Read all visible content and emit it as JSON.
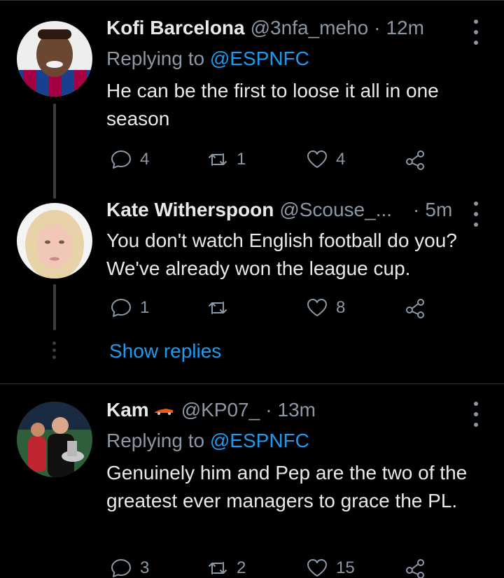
{
  "tweets": [
    {
      "name": "Kofi Barcelona",
      "handle": "@3nfa_meho",
      "dot": "·",
      "time": "12m",
      "replying_label": "Replying to",
      "replying_handle": "@ESPNFC",
      "text": "He can be the first to loose it all in one season",
      "replies": "4",
      "retweets": "1",
      "likes": "4",
      "avatar_colors": [
        "#7a1e3a",
        "#1b3f8f",
        "#c9a227"
      ]
    },
    {
      "name": "Kate Witherspoon",
      "handle": "@Scouse_...",
      "dot": "·",
      "time": "5m",
      "text": "You don't watch English football do you? We've already won the league cup.",
      "replies": "1",
      "retweets": "",
      "likes": "8",
      "show_replies": "Show replies",
      "avatar_colors": [
        "#e8d3a8",
        "#f1c8b8"
      ]
    },
    {
      "name": "Kam",
      "handle": "@KP07_",
      "dot": "·",
      "time": "13m",
      "replying_label": "Replying to",
      "replying_handle": "@ESPNFC",
      "text": "Genuinely him and Pep are the two of the greatest ever managers to grace the PL.",
      "replies": "3",
      "retweets": "2",
      "likes": "15",
      "avatar_colors": [
        "#2e5f3a",
        "#c0262f",
        "#111111"
      ]
    }
  ],
  "accent_color": "#1d9bf0",
  "muted_color": "#8b98a5"
}
